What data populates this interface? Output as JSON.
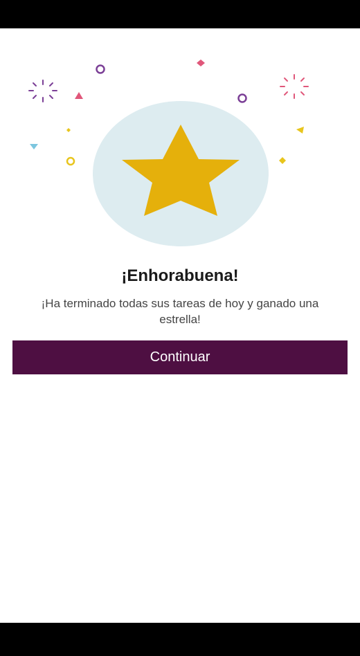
{
  "celebration": {
    "title": "¡Enhorabuena!",
    "message": "¡Ha terminado todas sus tareas de hoy y ganado una estrella!",
    "continue_label": "Continuar"
  },
  "icons": {
    "main": "star-icon",
    "decorations": "confetti"
  },
  "colors": {
    "star": "#e5b00b",
    "badge_background": "#ddecf0",
    "button": "#4e0f42",
    "button_text": "#ffffff",
    "confetti_purple": "#7b3f96",
    "confetti_pink": "#e0577a",
    "confetti_yellow": "#e8c51d",
    "confetti_blue": "#7cc6df"
  }
}
